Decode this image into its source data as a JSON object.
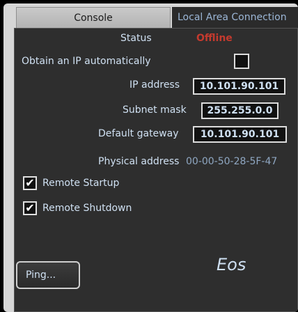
{
  "tabs": [
    {
      "label": "Console"
    },
    {
      "label": "Local Area Connection"
    }
  ],
  "status": {
    "label": "Status",
    "value": "Offline"
  },
  "dhcp": {
    "label": "Obtain an IP automatically",
    "checked": false
  },
  "ip": {
    "label": "IP address",
    "value": "10.101.90.101"
  },
  "subnet": {
    "label": "Subnet mask",
    "value": "255.255.0.0"
  },
  "gateway": {
    "label": "Default gateway",
    "value": "10.101.90.101"
  },
  "physical": {
    "label": "Physical address",
    "value": "00-00-50-28-5F-47"
  },
  "remote_startup": {
    "label": "Remote Startup",
    "checked": true,
    "mark": "✔"
  },
  "remote_shutdown": {
    "label": "Remote Shutdown",
    "checked": true,
    "mark": "✔"
  },
  "ping": {
    "label": "Ping..."
  },
  "console_name": "Eos",
  "colors": {
    "offline": "#c43a2e",
    "text": "#cfe0f2",
    "panel": "#2e2e2e"
  }
}
